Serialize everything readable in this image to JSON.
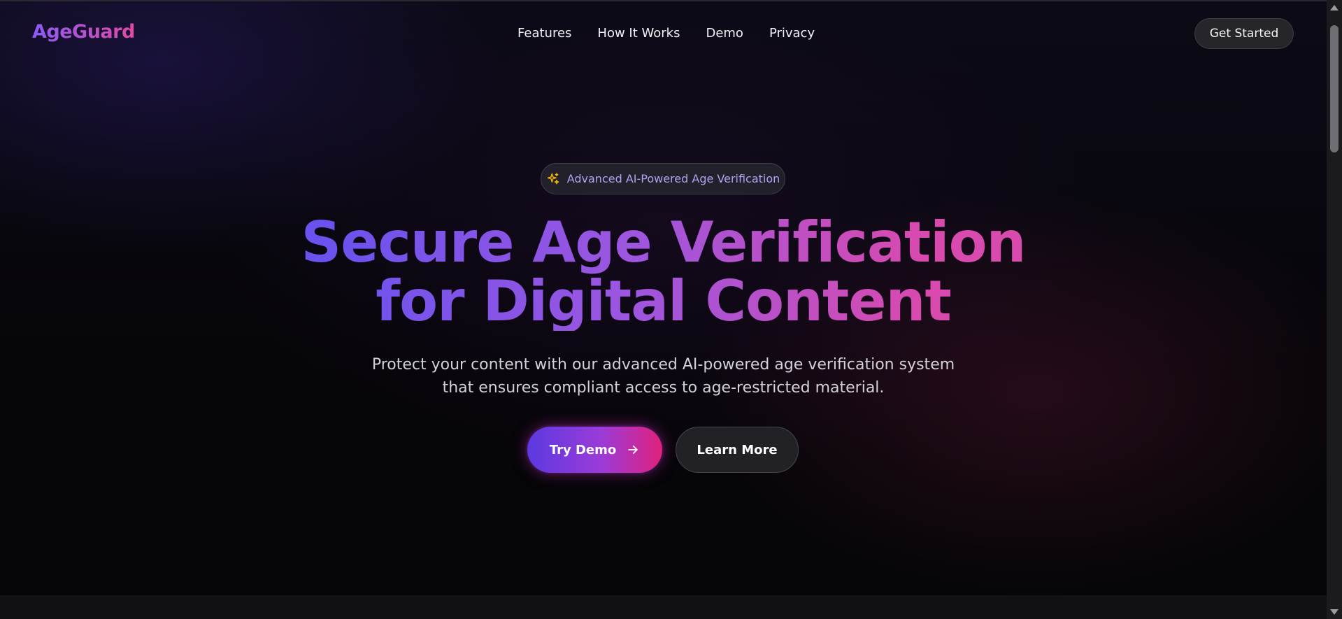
{
  "brand": {
    "logo_text": "AgeGuard",
    "gradient_start": "#8a5cf6",
    "gradient_end": "#e14aa4"
  },
  "nav": {
    "links": [
      {
        "label": "Features"
      },
      {
        "label": "How It Works"
      },
      {
        "label": "Demo"
      },
      {
        "label": "Privacy"
      }
    ],
    "cta_label": "Get Started"
  },
  "hero": {
    "badge": {
      "icon": "sparkles-icon",
      "text": "Advanced AI-Powered Age Verification"
    },
    "headline_line1": "Secure Age Verification",
    "headline_line2": "for Digital Content",
    "subtitle_line1": "Protect your content with our advanced AI-powered age verification system",
    "subtitle_line2": "that ensures compliant access to age-restricted material.",
    "primary_cta": {
      "label": "Try Demo",
      "icon": "arrow-right-icon"
    },
    "secondary_cta": {
      "label": "Learn More"
    }
  },
  "colors": {
    "background": "#050507",
    "primary_gradient_start": "#5b3ae0",
    "primary_gradient_end": "#e0217c",
    "badge_text": "#a9a5f2",
    "sparkle": "#f5b300"
  }
}
